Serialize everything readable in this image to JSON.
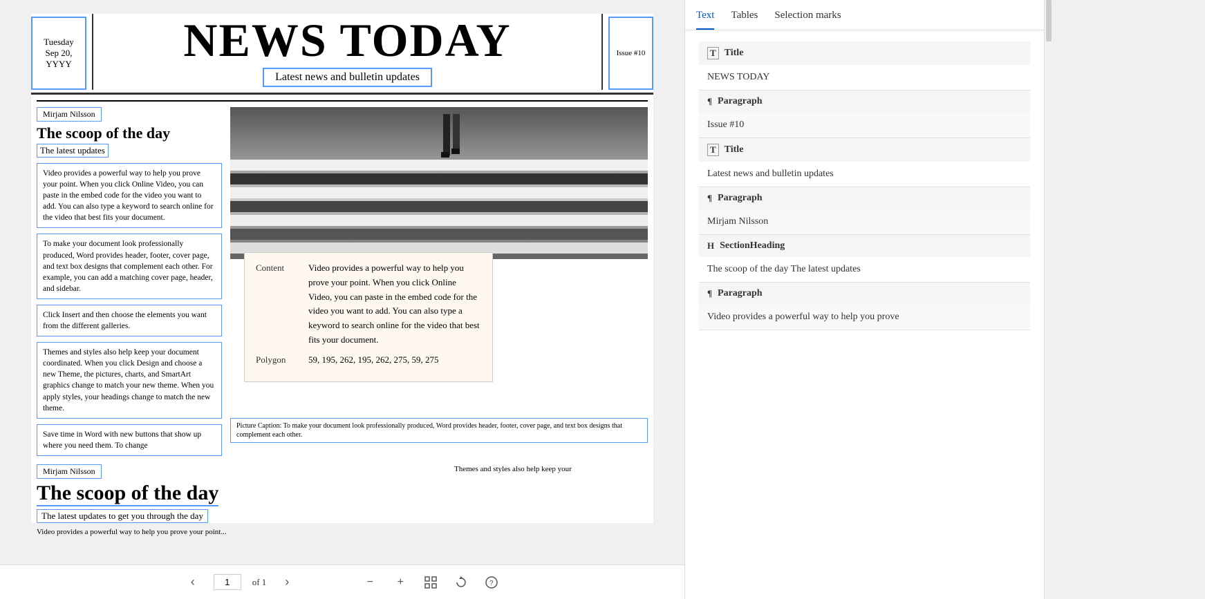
{
  "document": {
    "date": {
      "line1": "Tuesday",
      "line2": "Sep 20,",
      "line3": "YYYY"
    },
    "main_title": "NEWS TODAY",
    "subtitle": "Latest news and bulletin updates",
    "issue": "Issue #10",
    "articles": [
      {
        "author": "Mirjam Nilsson",
        "heading": "The scoop of the day",
        "subheading": "The latest updates",
        "paragraphs": [
          "Video provides a powerful way to help you prove your point. When you click Online Video, you can paste in the embed code for the video you want to add. You can also type a keyword to search online for the video that best fits your document.",
          "To make your document look professionally produced, Word provides header, footer, cover page, and text box designs that complement each other. For example, you can add a matching cover page, header, and sidebar.",
          "Click Insert and then choose the elements you want from the different galleries.",
          "Themes and styles also help keep your document coordinated. When you click Design and choose a new Theme, the pictures, charts, and SmartArt graphics change to match your new theme. When you apply styles, your headings change to match the new theme.",
          "Save time in Word with new buttons that show up where you need them. To change"
        ],
        "tooltip": {
          "content_label": "Content",
          "content_text": "Video provides a powerful way to help you prove your point. When you click Online Video, you can paste in the embed code for the video you want to add. You can also type a keyword to search online for the video that best fits your document.",
          "polygon_label": "Polygon",
          "polygon_text": "59, 195, 262, 195, 262, 275, 59, 275"
        },
        "caption": "Picture Caption: To make your document look professionally produced, Word provides header, footer, cover page, and text box designs that complement each other."
      },
      {
        "author": "Mirjam Nilsson",
        "heading": "The scoop of the day",
        "subheading": "The latest updates to get you through the day",
        "right_text": "Themes and styles also help keep your"
      }
    ]
  },
  "pagination": {
    "prev_label": "‹",
    "next_label": "›",
    "current_page": "1",
    "of_label": "of 1",
    "zoom_out": "−",
    "zoom_in": "+",
    "rotate": "⟳",
    "fit": "⊡"
  },
  "right_panel": {
    "tabs": [
      {
        "id": "text",
        "label": "Text",
        "active": true
      },
      {
        "id": "tables",
        "label": "Tables",
        "active": false
      },
      {
        "id": "selection-marks",
        "label": "Selection marks",
        "active": false
      }
    ],
    "sections": [
      {
        "type": "Title",
        "icon": "T",
        "content": "NEWS TODAY"
      },
      {
        "type": "Paragraph",
        "icon": "¶",
        "content": "Issue #10"
      },
      {
        "type": "Title",
        "icon": "T",
        "content": "Latest news and bulletin updates"
      },
      {
        "type": "Paragraph",
        "icon": "¶",
        "content": "Mirjam Nilsson"
      },
      {
        "type": "SectionHeading",
        "icon": "H",
        "content": "The scoop of the day The latest updates"
      },
      {
        "type": "Paragraph",
        "icon": "¶",
        "content": "Video provides a powerful way to help you prove"
      }
    ]
  }
}
